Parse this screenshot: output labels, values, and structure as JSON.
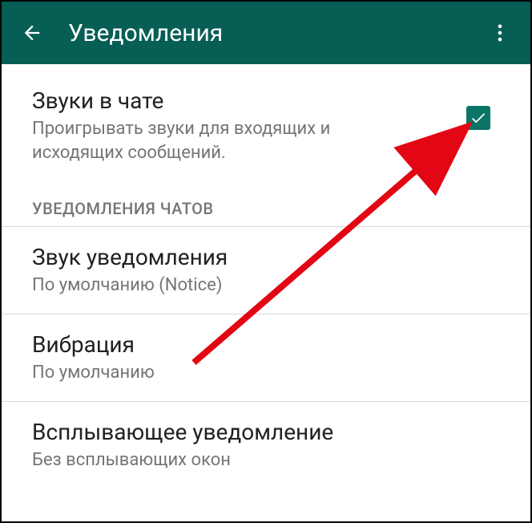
{
  "header": {
    "title": "Уведомления"
  },
  "settings": {
    "chat_sounds": {
      "title": "Звуки в чате",
      "subtitle": "Проигрывать звуки для входящих и исходящих сообщений.",
      "checked": true
    },
    "section_header": "УВЕДОМЛЕНИЯ ЧАТОВ",
    "notification_sound": {
      "title": "Звук уведомления",
      "subtitle": "По умолчанию (Notice)"
    },
    "vibration": {
      "title": "Вибрация",
      "subtitle": "По умолчанию"
    },
    "popup": {
      "title": "Всплывающее уведомление",
      "subtitle": "Без всплывающих окон"
    }
  }
}
